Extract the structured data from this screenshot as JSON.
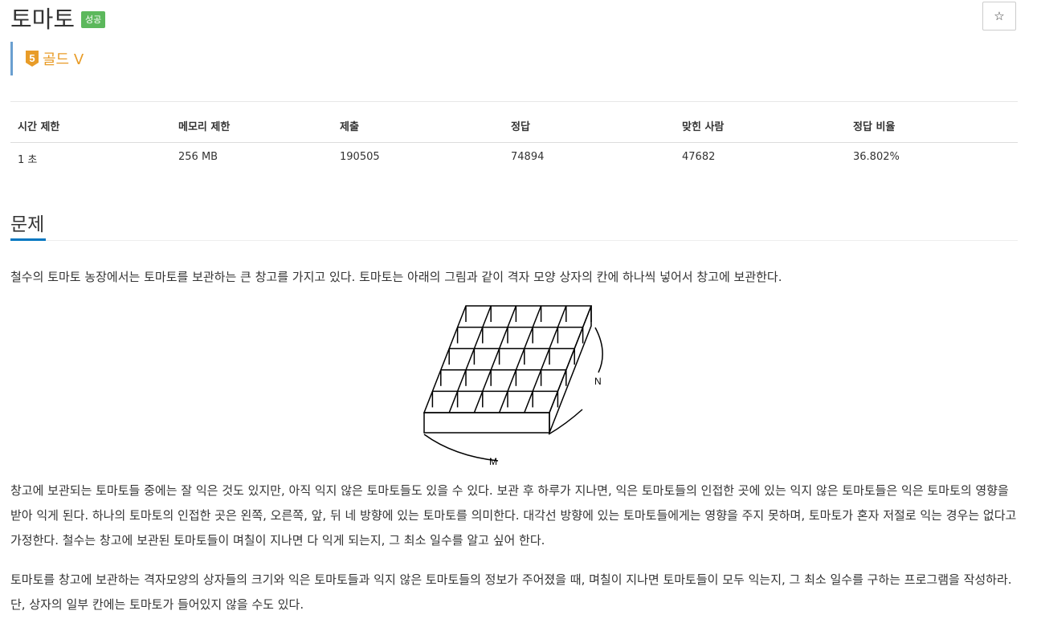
{
  "header": {
    "title": "토마토",
    "status_badge": "성공",
    "star_icon": "star-icon",
    "star_glyph": "☆"
  },
  "tier": {
    "icon": "gold-5-tier-icon",
    "icon_number": "5",
    "label": "골드 V",
    "color": "#e89c28"
  },
  "info_table": {
    "headers": [
      "시간 제한",
      "메모리 제한",
      "제출",
      "정답",
      "맞힌 사람",
      "정답 비율"
    ],
    "values": [
      "1 초",
      "256 MB",
      "190505",
      "74894",
      "47682",
      "36.802%"
    ]
  },
  "problem": {
    "section_title": "문제",
    "paragraph1": "철수의 토마토 농장에서는 토마토를 보관하는 큰 창고를 가지고 있다. 토마토는 아래의 그림과 같이 격자 모양 상자의 칸에 하나씩 넣어서 창고에 보관한다.",
    "figure": {
      "label_m": "M",
      "label_n": "N"
    },
    "paragraph2": "창고에 보관되는 토마토들 중에는 잘 익은 것도 있지만, 아직 익지 않은 토마토들도 있을 수 있다. 보관 후 하루가 지나면, 익은 토마토들의 인접한 곳에 있는 익지 않은 토마토들은 익은 토마토의 영향을 받아 익게 된다. 하나의 토마토의 인접한 곳은 왼쪽, 오른쪽, 앞, 뒤 네 방향에 있는 토마토를 의미한다. 대각선 방향에 있는 토마토들에게는 영향을 주지 못하며, 토마토가 혼자 저절로 익는 경우는 없다고 가정한다. 철수는 창고에 보관된 토마토들이 며칠이 지나면 다 익게 되는지, 그 최소 일수를 알고 싶어 한다.",
    "paragraph3": "토마토를 창고에 보관하는 격자모양의 상자들의 크기와 익은 토마토들과 익지 않은 토마토들의 정보가 주어졌을 때, 며칠이 지나면 토마토들이 모두 익는지, 그 최소 일수를 구하는 프로그램을 작성하라. 단, 상자의 일부 칸에는 토마토가 들어있지 않을 수도 있다."
  },
  "colors": {
    "badge": "#5cb85c",
    "accent": "#0076c0",
    "tier_border": "#6a9fd0"
  }
}
